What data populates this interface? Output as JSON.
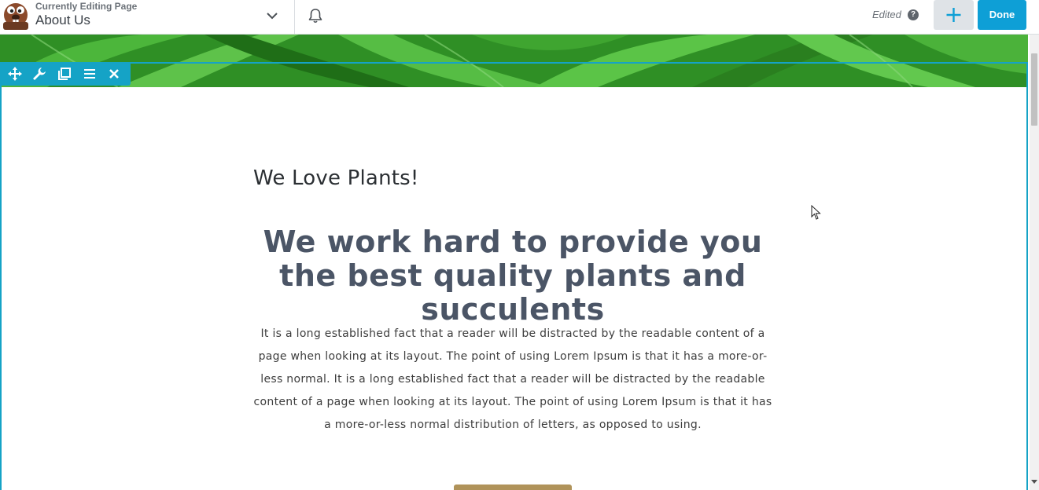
{
  "topbar": {
    "caption": "Currently Editing Page",
    "page_name": "About Us",
    "status": "Edited",
    "help_glyph": "?",
    "add_icon": "plus-icon",
    "done_label": "Done"
  },
  "row_toolbar": {
    "icons": [
      "move-icon",
      "wrench-icon",
      "duplicate-icon",
      "menu-icon",
      "close-icon"
    ]
  },
  "content": {
    "section_title": "We Love Plants!",
    "headline": "We work hard to provide you the best quality plants and succulents",
    "body": "It is a long established fact that a reader will be distracted by the readable content of a page when looking at its layout. The point of using Lorem Ipsum is that it has a more-or-less normal. It is a long established fact that a reader will be distracted by the readable content of a page when looking at its layout. The point of using Lorem Ipsum is that it has a more-or-less normal distribution of letters, as opposed to using."
  },
  "colors": {
    "accent": "#0e9fd6",
    "row_highlight": "#15a3c6",
    "leaf_green": "#2e8a22",
    "button_gold": "#b0935a",
    "headline": "#4b5566"
  }
}
